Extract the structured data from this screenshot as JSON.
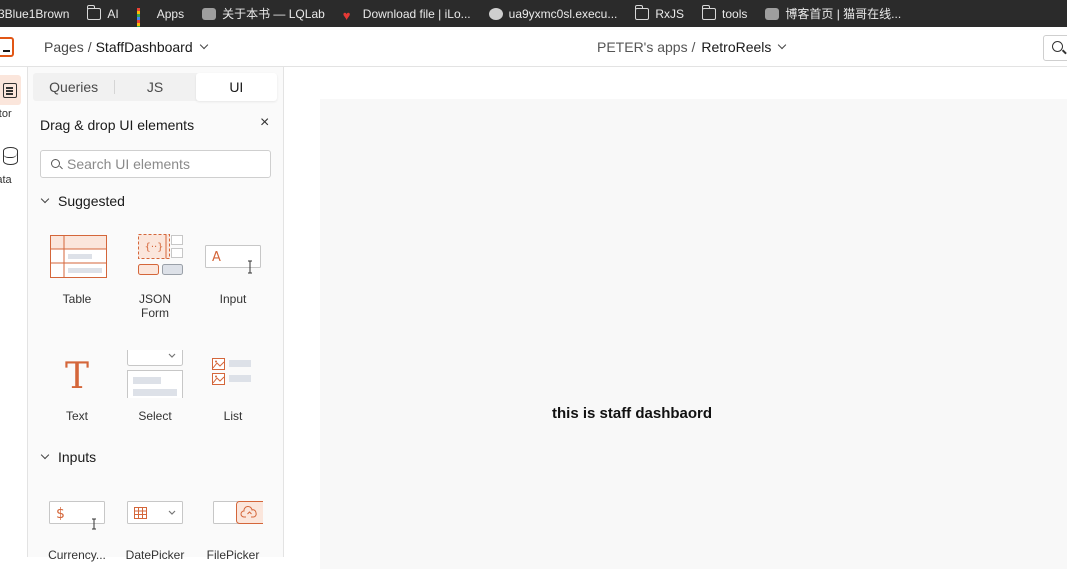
{
  "bookmarks": [
    {
      "label": "3Blue1Brown",
      "icon": "none"
    },
    {
      "label": "AI",
      "icon": "folder-icon"
    },
    {
      "label": "Apps",
      "icon": "apps-grid-icon"
    },
    {
      "label": "关于本书 — LQLab",
      "icon": "face-icon"
    },
    {
      "label": "Download file | iLo...",
      "icon": "heart-icon"
    },
    {
      "label": "ua9yxmc0sl.execu...",
      "icon": "globe-icon"
    },
    {
      "label": "RxJS",
      "icon": "folder-icon"
    },
    {
      "label": "tools",
      "icon": "folder-icon"
    },
    {
      "label": "博客首页 | 猫哥在线...",
      "icon": "face-icon"
    }
  ],
  "header": {
    "breadcrumb_root": "Pages",
    "breadcrumb_sep": "/",
    "page_name": "StaffDashboard",
    "workspace": "PETER's apps /",
    "app_name": "RetroReels"
  },
  "rail": {
    "editor_label": "itor",
    "data_label": "ata"
  },
  "panel": {
    "tabs": [
      "Queries",
      "JS",
      "UI"
    ],
    "active_tab": "UI",
    "title": "Drag & drop UI elements",
    "close": "×",
    "search_placeholder": "Search UI elements",
    "sections": {
      "suggested": "Suggested",
      "inputs": "Inputs"
    },
    "widgets": {
      "table": "Table",
      "json_form_1": "JSON",
      "json_form_2": "Form",
      "input": "Input",
      "text": "Text",
      "select": "Select",
      "list": "List",
      "currency": "Currency...",
      "datepicker": "DatePicker",
      "filepicker": "FilePicker"
    }
  },
  "canvas": {
    "text": "this is staff dashbaord"
  },
  "colors": {
    "accent": "#e15615",
    "accent_light": "#fbe6dc",
    "widget_gray": "#dde1e8"
  }
}
